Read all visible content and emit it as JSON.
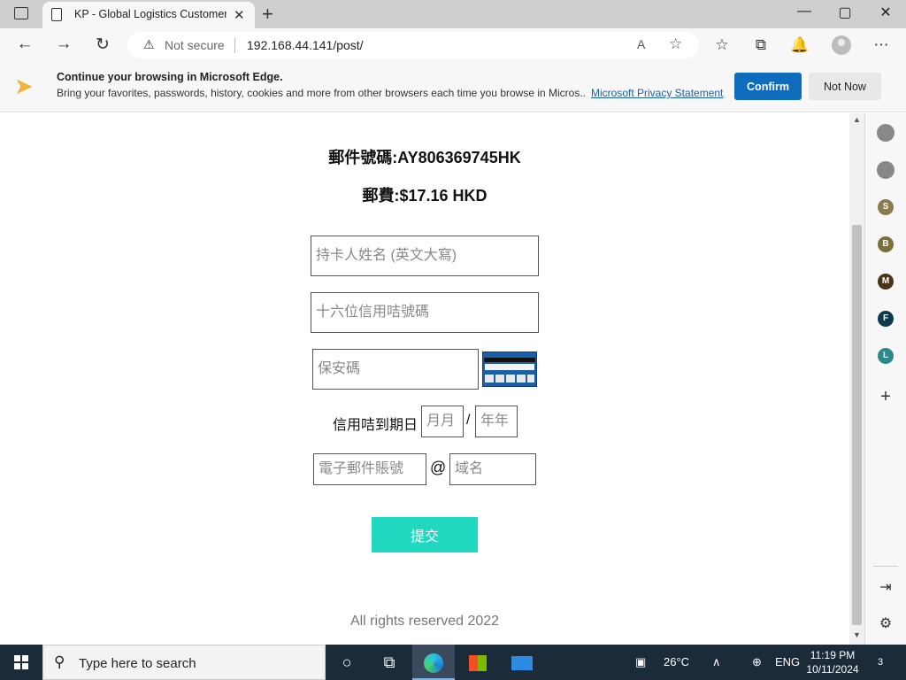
{
  "browser": {
    "tab_title": "KP - Global Logistics Customer d",
    "tab_close": "✕",
    "new_tab": "+",
    "security_label": "Not secure",
    "url": "192.168.44.141/post/",
    "window_controls": [
      "—",
      "▢",
      "✕"
    ]
  },
  "banner": {
    "heading": "Continue your browsing in Microsoft Edge.",
    "body": "Bring your favorites, passwords, history, cookies and more from other browsers each time you browse in Micros...",
    "privacy_link": "Microsoft Privacy Statement",
    "confirm_label": "Confirm",
    "not_now_label": "Not Now"
  },
  "page": {
    "tracking_line": "郵件號碼:AY806369745HK",
    "fee_line": "郵費:$17.16 HKD",
    "cardholder_placeholder": "持卡人姓名 (英文大寫)",
    "card_number_placeholder": "十六位信用咭號碼",
    "cvv_placeholder": "保安碼",
    "expiry_label": "信用咭到期日",
    "month_placeholder": "月月",
    "slash": "/",
    "year_placeholder": "年年",
    "email_placeholder": "電子郵件賬號",
    "at_sign": "@",
    "domain_placeholder": "域名",
    "submit_label": "提交",
    "footer": "All rights reserved 2022"
  },
  "sidebar": {
    "letters": [
      {
        "letter": "S",
        "color": "#8a7a4e"
      },
      {
        "letter": "B",
        "color": "#7a6e3a"
      },
      {
        "letter": "M",
        "color": "#4a3418"
      },
      {
        "letter": "F",
        "color": "#0e3b4a"
      },
      {
        "letter": "L",
        "color": "#2a8a88"
      }
    ],
    "add": "+"
  },
  "taskbar": {
    "search_text": "Type here to search",
    "weather": "26°C",
    "language": "ENG",
    "time": "11:19 PM",
    "date": "10/11/2024",
    "notification_count": "3"
  },
  "colors": {
    "submit": "#20d8c0",
    "confirm": "#0f6cbd",
    "taskbar": "#1c2b3a"
  }
}
